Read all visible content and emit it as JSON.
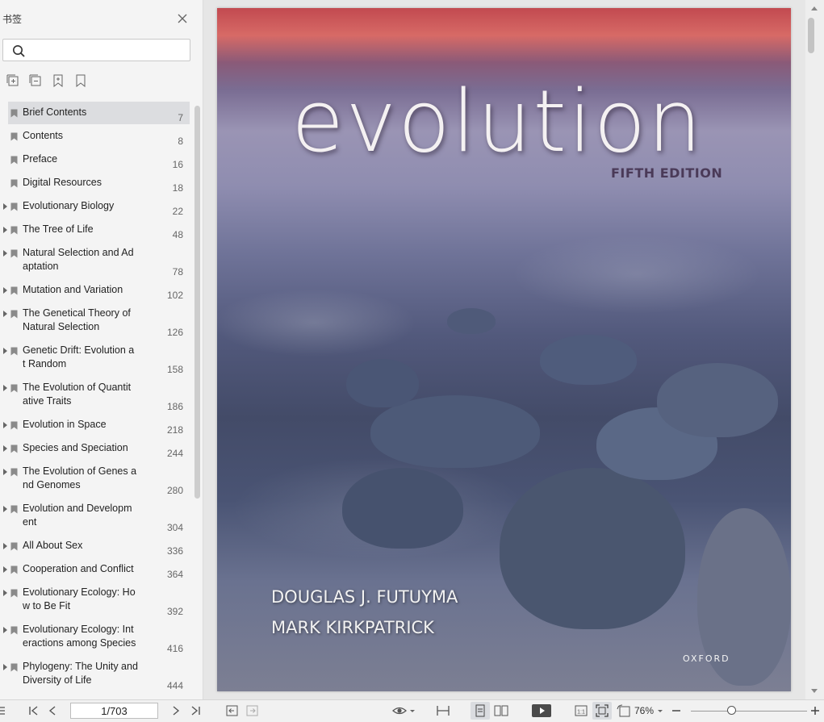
{
  "sidebar": {
    "title": "书签",
    "search": {
      "value": "",
      "placeholder": ""
    },
    "tools": [
      "expand-all-icon",
      "collapse-all-icon",
      "add-bookmark-icon",
      "bookmark-icon"
    ],
    "bookmarks": [
      {
        "label": "Brief Contents",
        "page": "7",
        "expandable": false,
        "selected": true
      },
      {
        "label": "Contents",
        "page": "8",
        "expandable": false
      },
      {
        "label": "Preface",
        "page": "16",
        "expandable": false
      },
      {
        "label": "Digital Resources",
        "page": "18",
        "expandable": false
      },
      {
        "label": "Evolutionary Biology",
        "page": "22",
        "expandable": true
      },
      {
        "label": "The Tree of Life",
        "page": "48",
        "expandable": true
      },
      {
        "label": "Natural Selection and Ad\naptation",
        "page": "78",
        "expandable": true
      },
      {
        "label": "Mutation and Variation",
        "page": "102",
        "expandable": true
      },
      {
        "label": "The Genetical Theory of\nNatural Selection",
        "page": "126",
        "expandable": true
      },
      {
        "label": "Genetic Drift: Evolution a\nt Random",
        "page": "158",
        "expandable": true
      },
      {
        "label": "The Evolution of Quantit\native Traits",
        "page": "186",
        "expandable": true
      },
      {
        "label": "Evolution in Space",
        "page": "218",
        "expandable": true
      },
      {
        "label": "Species and Speciation",
        "page": "244",
        "expandable": true
      },
      {
        "label": "The Evolution of Genes a\nnd Genomes",
        "page": "280",
        "expandable": true
      },
      {
        "label": "Evolution and Developm\nent",
        "page": "304",
        "expandable": true
      },
      {
        "label": "All About Sex",
        "page": "336",
        "expandable": true
      },
      {
        "label": "Cooperation and Conflict",
        "page": "364",
        "expandable": true
      },
      {
        "label": "Evolutionary Ecology: Ho\nw to Be Fit",
        "page": "392",
        "expandable": true
      },
      {
        "label": "Evolutionary Ecology: Int\neractions among Species",
        "page": "416",
        "expandable": true
      },
      {
        "label": "Phylogeny: The Unity and\nDiversity of Life",
        "page": "444",
        "expandable": true
      }
    ]
  },
  "cover": {
    "title": "evolution",
    "edition": "FIFTH EDITION",
    "authors": [
      "DOUGLAS J. FUTUYMA",
      "MARK KIRKPATRICK"
    ],
    "publisher": "OXFORD"
  },
  "statusbar": {
    "page_indicator": "1/703",
    "zoom": "76%"
  }
}
